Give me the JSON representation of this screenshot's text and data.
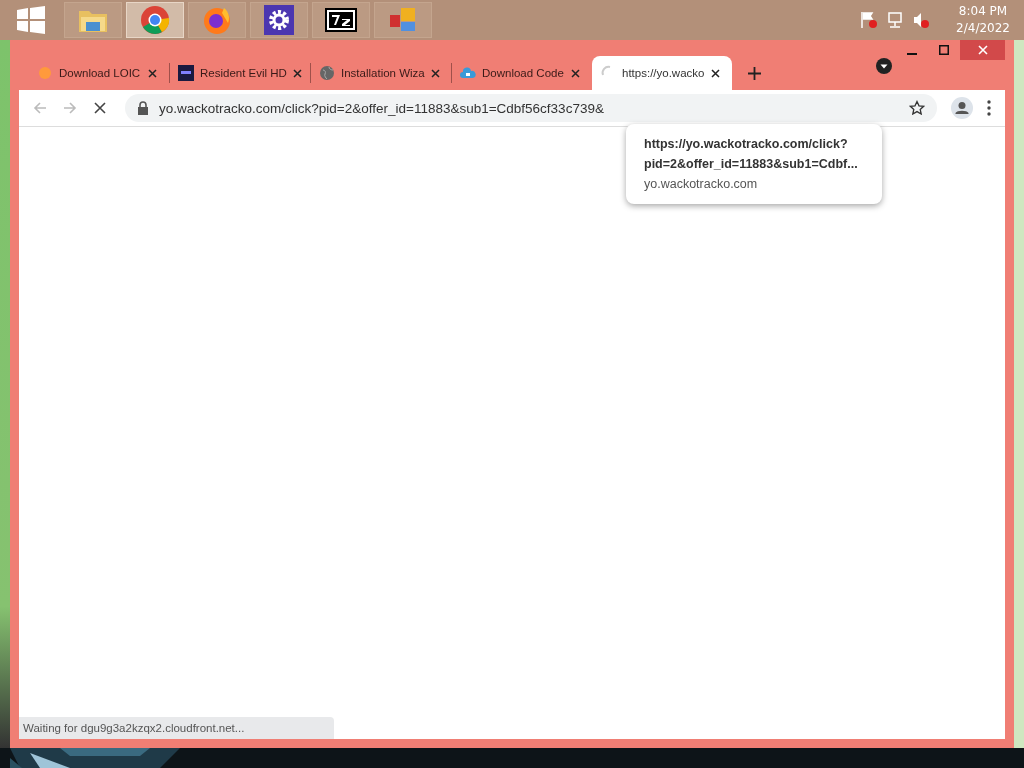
{
  "taskbar": {
    "apps": [
      {
        "kind": "start",
        "selected": false
      },
      {
        "kind": "folder",
        "selected": false
      },
      {
        "kind": "chrome",
        "selected": true
      },
      {
        "kind": "firefox",
        "selected": false
      },
      {
        "kind": "gear",
        "selected": false
      },
      {
        "kind": "sevenzip",
        "selected": false
      },
      {
        "kind": "blocks",
        "selected": false
      }
    ],
    "clock": {
      "time": "8:04 PM",
      "date": "2/4/2022"
    }
  },
  "browser": {
    "tabs": [
      {
        "title": "Download LOIC",
        "kind": "orange",
        "selected": false
      },
      {
        "title": "Resident Evil HD",
        "kind": "dark",
        "selected": false
      },
      {
        "title": "Installation Wiza",
        "kind": "globe",
        "selected": false
      },
      {
        "title": "Download Code",
        "kind": "cloud",
        "selected": false
      },
      {
        "title": "https://yo.wacko",
        "kind": "loading",
        "selected": true
      }
    ],
    "address": "yo.wackotracko.com/click?pid=2&offer_id=11883&sub1=Cdbf56cf33c739&",
    "tooltip": {
      "title": "https://yo.wackotracko.com/click?\npid=2&offer_id=11883&sub1=Cdbf...",
      "domain": "yo.wackotracko.com"
    },
    "status": "Waiting for dgu9g3a2kzqx2.cloudfront.net..."
  }
}
